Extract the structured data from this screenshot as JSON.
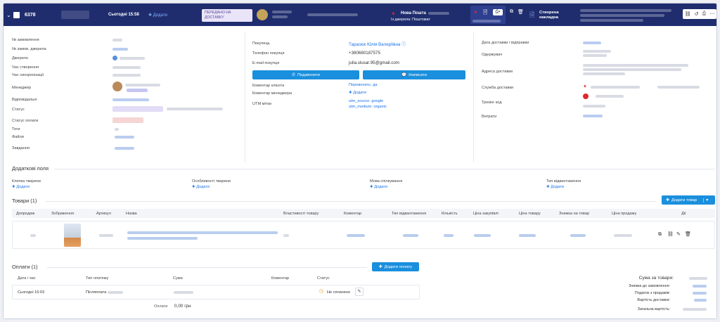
{
  "header": {
    "order_id": "6378",
    "date": "Сьогодні 15:58",
    "add_label": "Додати",
    "delivered_badge": "ПЕРЕДАНО НА ДОСТАВКУ",
    "carrier": "Нова Пошта",
    "carrier_source": "Із джерела: Поштомат",
    "waybill": "Створена накладна"
  },
  "left": {
    "labels": [
      "№ замовлення",
      "№ замов. джерела",
      "Джерело",
      "Час створення",
      "Час синхронізації",
      "Менеджер",
      "Відповідальні",
      "Статус",
      "Статус оплати",
      "Теги",
      "Файли",
      "Завдання"
    ]
  },
  "buyer": {
    "buyer_label": "Покупець",
    "buyer_name": "Тарасюк Юлія Валеріївна",
    "phone_label": "Телефон покупця",
    "phone": "+380680187575",
    "email_label": "E-mail покупця",
    "email": "julia.slusar.95@gmail.com",
    "call_btn": "Подзвонити",
    "write_btn": "Написати",
    "client_comment_label": "Коментар клієнта",
    "client_comment": "Перевонить: да",
    "manager_comment_label": "Коментар менеджера",
    "manager_comment_add": "Додати",
    "utm_label": "UTM мітки",
    "utm_source": "utm_source: google",
    "utm_medium": "utm_medium: organic"
  },
  "delivery": {
    "labels": [
      "Дата доставки / відправки",
      "Одержувач",
      "Адреса доставки",
      "Служба доставки",
      "Трекінг код",
      "Витрати"
    ]
  },
  "extra": {
    "title": "Додаткові поля",
    "fields": [
      {
        "label": "Кличка тварини",
        "add": "Додати"
      },
      {
        "label": "Особливості тварини",
        "add": "Додати"
      },
      {
        "label": "Мова спілкування",
        "add": "Додати"
      },
      {
        "label": "Тип відвантаження",
        "add": "Додати"
      }
    ]
  },
  "products": {
    "title": "Товари (1)",
    "add_btn": "Додати товар",
    "columns": [
      "Допродаж",
      "Зображення",
      "Артикул",
      "Назва",
      "Властивості товару",
      "Коментар",
      "Тип відвантаження",
      "Кількість",
      "Ціна закупівлі",
      "Ціна товару",
      "Знижка на товар",
      "Ціна продажу",
      "Дії"
    ]
  },
  "payments": {
    "title": "Оплати (1)",
    "add_btn": "Додати оплату",
    "columns": [
      "Дата і час",
      "Тип платежу",
      "Сума",
      "Коментар",
      "Статус"
    ],
    "row": {
      "date": "Сьогодні 16:03",
      "type": "Післяплата",
      "status": "Не сплачено"
    },
    "paid_label": "Оплати",
    "paid_value": "0,00 грн"
  },
  "totals": {
    "labels": [
      "Сума за товари:",
      "Знижка до замовлення:",
      "Податок з продажів:",
      "Вартість доставки:",
      "Загальна вартість:"
    ]
  },
  "icons": {
    "check": "checkbox-icon",
    "accent": "#1f2d6e",
    "brand_blue": "#1a8fdd",
    "np_red": "#e1262d"
  }
}
